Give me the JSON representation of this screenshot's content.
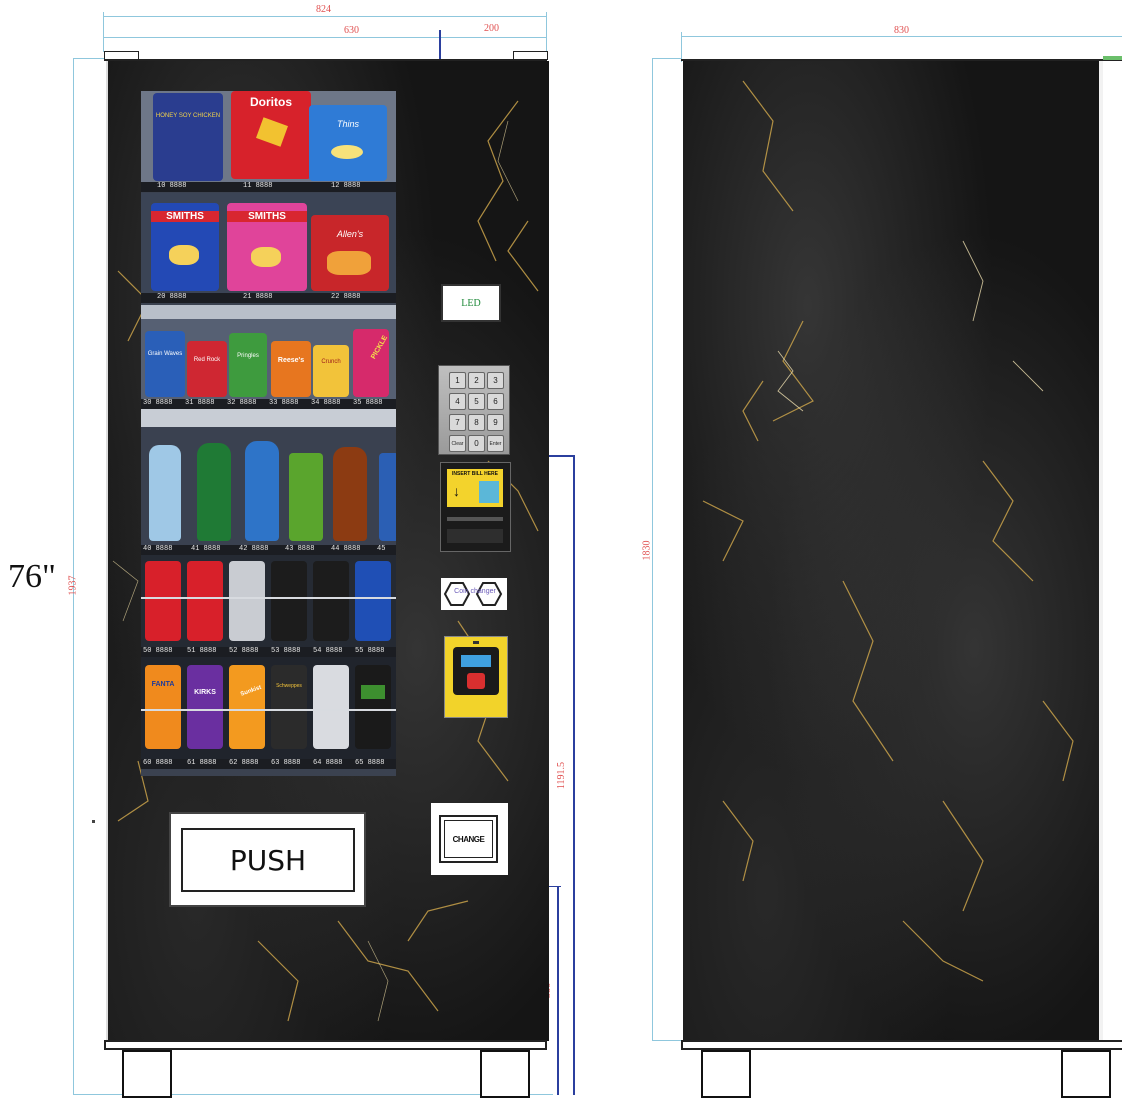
{
  "dimensions": {
    "total_width": "824",
    "cabinet_width": "630",
    "side_width": "200",
    "right_width": "830",
    "total_height": "1937",
    "right_height": "1830",
    "mid_height": "1191.5",
    "low_height": "386",
    "height_inches": "76\""
  },
  "panel": {
    "led_label": "LED",
    "keypad_keys": [
      "1",
      "2",
      "3",
      "4",
      "5",
      "6",
      "7",
      "8",
      "9",
      "Clear",
      "0",
      "Enter"
    ],
    "bill_text": "INSERT BILL HERE",
    "coin_label": "Coin changer",
    "change_label": "CHANGE",
    "push_label": "PUSH"
  },
  "brands": {
    "row1": [
      "HONEY SOY CHICKEN",
      "Doritos",
      "Thins"
    ],
    "row2": [
      "SMITHS",
      "SMITHS",
      "Allen's"
    ],
    "row3": [
      "Grain Waves",
      "Red Rock",
      "Pringles",
      "Reese's",
      "Crunch",
      "PICKLE"
    ],
    "row6": [
      "FANTA",
      "KIRKS",
      "Sunkist",
      "Schweppes",
      "",
      ""
    ]
  },
  "slots": {
    "row1": [
      "10 8888",
      "11 8888",
      "12 8888"
    ],
    "row2": [
      "20 8888",
      "21 8888",
      "22 8888"
    ],
    "row3": [
      "30 8888",
      "31 8888",
      "32 8888",
      "33 8888",
      "34 8888",
      "35 8888"
    ],
    "row4": [
      "40 8888",
      "41 8888",
      "42 8888",
      "43 8888",
      "44 8888",
      "45"
    ],
    "row5": [
      "50 8888",
      "51 8888",
      "52 8888",
      "53 8888",
      "54 8888",
      "55 8888"
    ],
    "row6": [
      "60 8888",
      "61 8888",
      "62 8888",
      "63 8888",
      "64 8888",
      "65 8888"
    ]
  },
  "colors": {
    "marble": "#151515",
    "dim_line": "#8fc7dd",
    "dim_text": "#e05050",
    "navy_line": "#2b3f9e"
  }
}
